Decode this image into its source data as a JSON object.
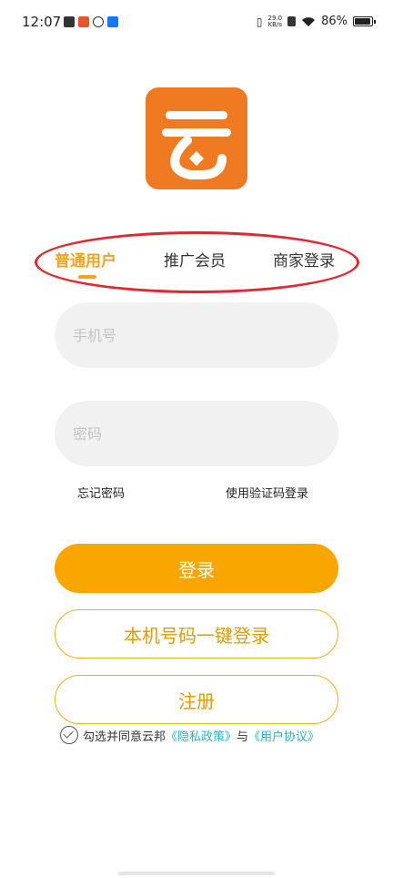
{
  "status_bar": {
    "time": "12:07",
    "net_speed_value": "29.0",
    "net_speed_unit": "KB/s",
    "battery": "86%",
    "battery_level": 0.86,
    "icons": [
      "mail-icon",
      "app-icon",
      "link-icon",
      "alipay-icon",
      "vibrate-icon",
      "sim-off-icon",
      "wifi-icon",
      "battery-icon"
    ]
  },
  "logo": {
    "icon": "yun-logo-icon",
    "color": "#f07a21"
  },
  "tabs": [
    {
      "label": "普通用户",
      "active": true
    },
    {
      "label": "推广会员",
      "active": false
    },
    {
      "label": "商家登录",
      "active": false
    }
  ],
  "form": {
    "phone_placeholder": "手机号",
    "password_placeholder": "密码",
    "forgot_password": "忘记密码",
    "sms_login": "使用验证码登录"
  },
  "buttons": {
    "login": "登录",
    "one_click_login": "本机号码一键登录",
    "register": "注册"
  },
  "agreement": {
    "prefix": "勾选并同意云邦",
    "privacy": "《隐私政策》",
    "and": "与",
    "user_agreement": "《用户协议》"
  },
  "colors": {
    "accent": "#f9a600",
    "highlight": "#e3262f",
    "link": "#27b3c2"
  }
}
